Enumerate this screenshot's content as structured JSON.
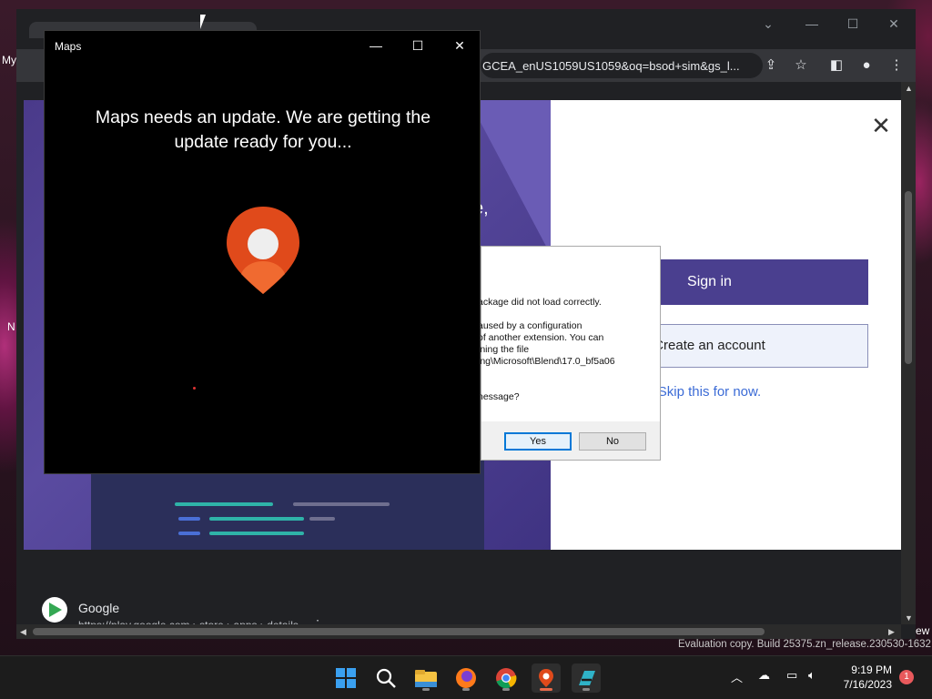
{
  "desktop": {
    "left_text_my": "My",
    "left_text_n": "N",
    "right_text_ew": "ew",
    "watermark": "Evaluation copy. Build 25375.zn_release.230530-1632"
  },
  "chrome": {
    "url": "GCEA_enUS1059US1059&oq=bsod+sim&gs_l...",
    "icons": [
      "share-icon",
      "star-icon",
      "sidebar-icon",
      "profile-icon",
      "menu-icon"
    ]
  },
  "signin_overlay": {
    "sign_in_label": "Sign in",
    "create_account_label": "Create an account",
    "skip_label": "Skip this for now.",
    "left_partial_text": "e,",
    "colors": {
      "primary": "#4a3f8f",
      "link": "#3b6bd6"
    }
  },
  "error_dialog": {
    "lines": [
      "ackage did not load correctly.",
      "aused by a configuration",
      "of another extension. You can",
      "ining the file",
      "ing\\Microsoft\\Blend\\17.0_bf5a06",
      "nessage?"
    ],
    "yes_label": "Yes",
    "no_label": "No"
  },
  "maps_window": {
    "title": "Maps",
    "message": "Maps needs an update. We are getting the update ready for you...",
    "accent_color": "#e04a1b"
  },
  "search_result": {
    "title": "Google",
    "url": "https://play.google.com › store › apps › details"
  },
  "taskbar": {
    "apps": [
      "windows-start-icon",
      "search-icon",
      "file-explorer-icon",
      "firefox-icon",
      "chrome-icon",
      "maps-icon",
      "blend-icon"
    ],
    "time": "9:19 PM",
    "date": "7/16/2023",
    "notification_count": "1"
  }
}
